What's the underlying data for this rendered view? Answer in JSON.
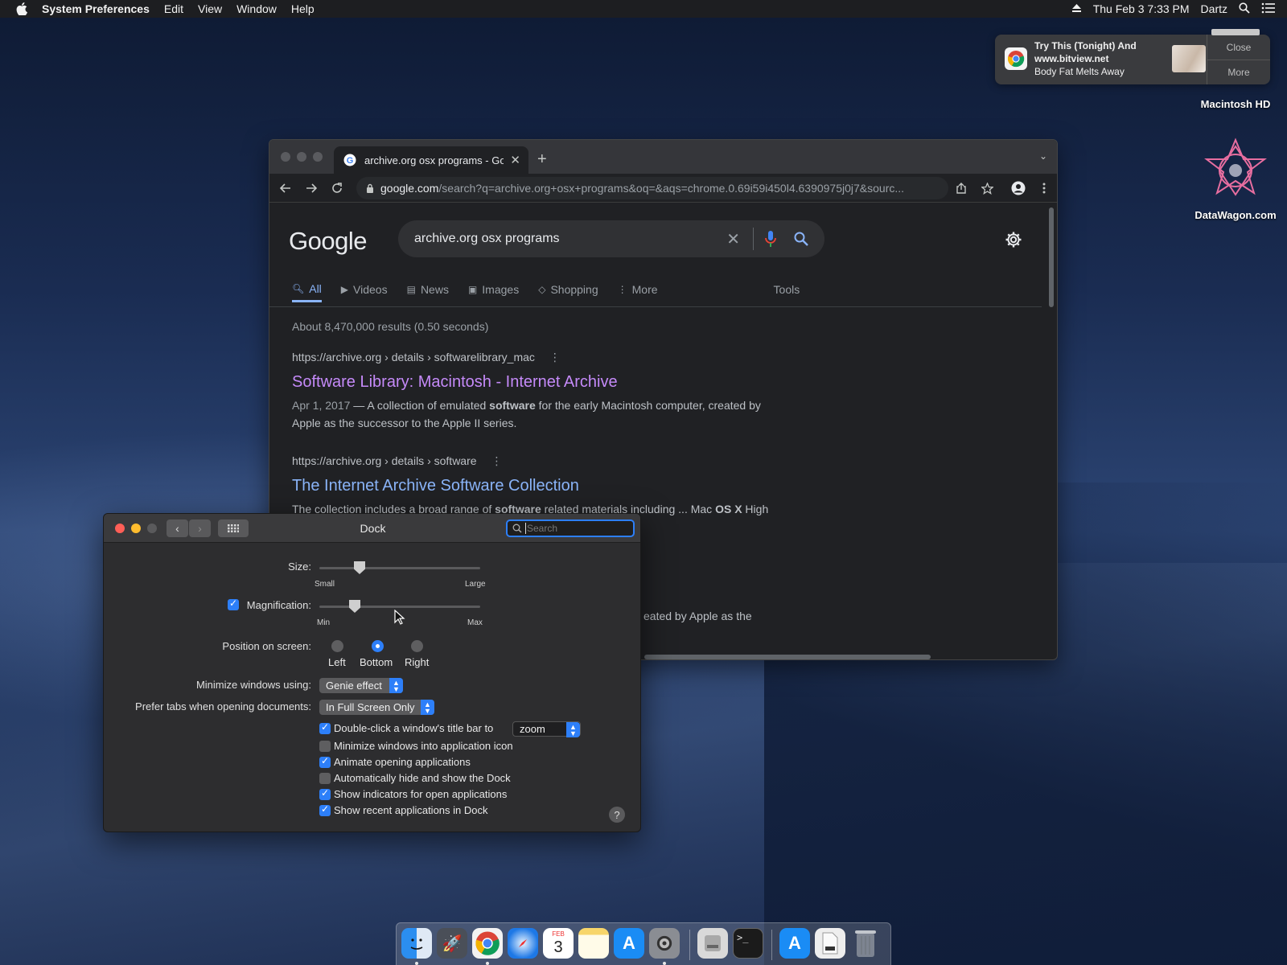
{
  "menubar": {
    "app": "System Preferences",
    "menus": [
      "Edit",
      "View",
      "Window",
      "Help"
    ],
    "clock": "Thu Feb 3  7:33 PM",
    "user": "Dartz"
  },
  "notification": {
    "title": "Try This (Tonight) And",
    "site": "www.bitview.net",
    "body": "Body Fat Melts Away",
    "close": "Close",
    "more": "More"
  },
  "desktop_icons": [
    "Macintosh HD",
    "DataWagon.com"
  ],
  "chrome": {
    "tab_title": "archive.org osx programs - Go",
    "url_host": "google.com",
    "url_path": "/search?q=archive.org+osx+programs&oq=&aqs=chrome.0.69i59i450l4.6390975j0j7&sourc...",
    "logo": "Google",
    "query": "archive.org osx programs",
    "tabs": [
      "All",
      "Videos",
      "News",
      "Images",
      "Shopping",
      "More"
    ],
    "tools": "Tools",
    "stats": "About 8,470,000 results (0.50 seconds)",
    "results": [
      {
        "cite": "https://archive.org › details › softwarelibrary_mac",
        "title": "Software Library: Macintosh - Internet Archive",
        "date": "Apr 1, 2017",
        "snippet_a": "A collection of emulated ",
        "snippet_bold": "software",
        "snippet_b": " for the early Macintosh computer, created by Apple as the successor to the Apple II series."
      },
      {
        "cite": "https://archive.org › details › software",
        "title": "The Internet Archive Software Collection",
        "snippet_a": "The collection includes a broad range of ",
        "snippet_bold": "software",
        "snippet_b": " related materials including ... Mac ",
        "snippet_bold2": "OS X",
        "snippet_c": " High"
      }
    ],
    "partial_snippet": "eated by Apple as the"
  },
  "prefs": {
    "title": "Dock",
    "search_placeholder": "Search",
    "size_label": "Size:",
    "size_min": "Small",
    "size_max": "Large",
    "size_value": 0.25,
    "magnification_label": "Magnification:",
    "mag_min": "Min",
    "mag_max": "Max",
    "magnification_value": 0.22,
    "magnification_enabled": true,
    "position_label": "Position on screen:",
    "positions": [
      "Left",
      "Bottom",
      "Right"
    ],
    "position_selected": "Bottom",
    "minimize_label": "Minimize windows using:",
    "minimize_value": "Genie effect",
    "tabs_label": "Prefer tabs when opening documents:",
    "tabs_value": "In Full Screen Only",
    "dblclick_label": "Double-click a window's title bar to",
    "dblclick_value": "zoom",
    "options": [
      {
        "label": "Minimize windows into application icon",
        "checked": false
      },
      {
        "label": "Animate opening applications",
        "checked": true
      },
      {
        "label": "Automatically hide and show the Dock",
        "checked": false
      },
      {
        "label": "Show indicators for open applications",
        "checked": true
      },
      {
        "label": "Show recent applications in Dock",
        "checked": true
      }
    ],
    "help": "?"
  },
  "dock": {
    "calendar_month": "FEB",
    "calendar_day": "3",
    "items": [
      "finder-icon",
      "launchpad-icon",
      "chrome-icon",
      "safari-icon",
      "calendar-icon",
      "notes-icon",
      "app-store-icon",
      "system-preferences-icon",
      "disk-utility-icon",
      "terminal-icon",
      "app-store-folder-icon",
      "document-icon",
      "trash-icon"
    ]
  },
  "colors": {
    "accent": "#2d7ff9",
    "link_visited": "#c58af9",
    "link": "#8ab4f8"
  }
}
